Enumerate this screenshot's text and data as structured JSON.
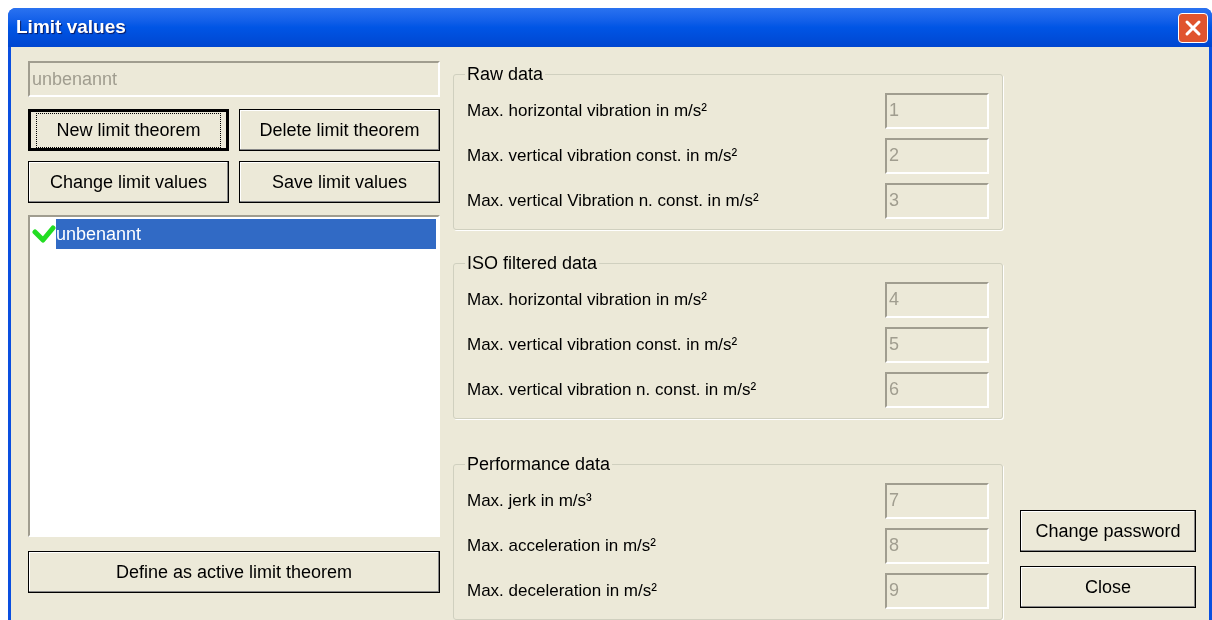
{
  "window": {
    "title": "Limit values"
  },
  "name_field": {
    "value": "unbenannt",
    "disabled": true
  },
  "buttons": [
    {
      "label": "New limit theorem",
      "default": true
    },
    {
      "label": "Delete limit theorem",
      "default": false
    },
    {
      "label": "Change limit values",
      "default": false
    },
    {
      "label": "Save limit values",
      "default": false
    }
  ],
  "list": {
    "items": [
      {
        "label": "unbenannt",
        "selected": true,
        "active": true
      }
    ]
  },
  "define_button": {
    "label": "Define as active limit theorem"
  },
  "groups": [
    {
      "title": "Raw data",
      "fields": [
        {
          "label": "Max. horizontal vibration in m/s²",
          "value": "1",
          "disabled": true
        },
        {
          "label": "Max. vertical vibration const. in m/s²",
          "value": "2",
          "disabled": true
        },
        {
          "label": "Max. vertical Vibration n. const. in m/s²",
          "value": "3",
          "disabled": true
        }
      ]
    },
    {
      "title": "ISO filtered data",
      "fields": [
        {
          "label": "Max. horizontal vibration in m/s²",
          "value": "4",
          "disabled": true
        },
        {
          "label": "Max. vertical vibration const. in m/s²",
          "value": "5",
          "disabled": true
        },
        {
          "label": "Max. vertical vibration n. const. in m/s²",
          "value": "6",
          "disabled": true
        }
      ]
    },
    {
      "title": "Performance data",
      "fields": [
        {
          "label": "Max. jerk in m/s³",
          "value": "7",
          "disabled": true
        },
        {
          "label": "Max. acceleration in m/s²",
          "value": "8",
          "disabled": true
        },
        {
          "label": "Max. deceleration in m/s²",
          "value": "9",
          "disabled": true
        }
      ]
    }
  ],
  "side_buttons": [
    {
      "label": "Change password"
    },
    {
      "label": "Close"
    }
  ]
}
